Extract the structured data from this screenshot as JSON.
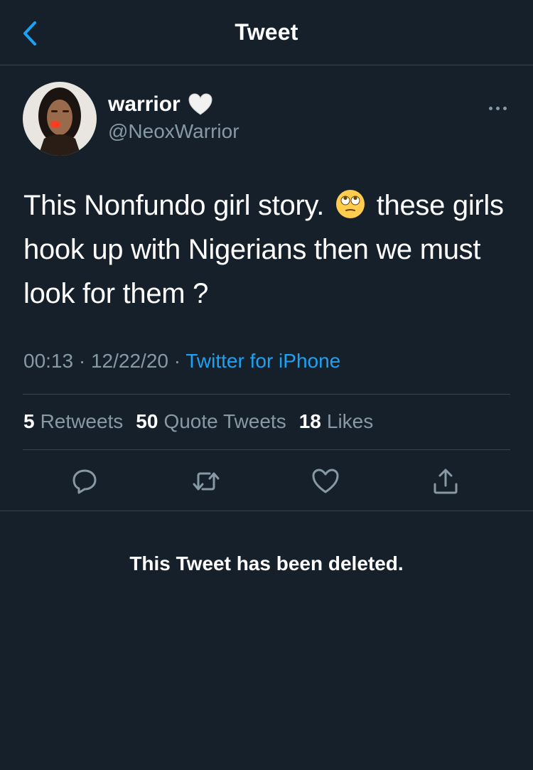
{
  "header": {
    "title": "Tweet",
    "back_icon": "chevron-left-icon"
  },
  "tweet": {
    "author": {
      "name": "warrior",
      "name_emoji": "white-heart-emoji",
      "handle": "@NeoxWarrior"
    },
    "text_part1": "This Nonfundo girl story.",
    "text_emoji": "face-with-rolling-eyes-emoji",
    "text_part2": "these girls hook up with Nigerians then we must look for them ?",
    "time": "00:13",
    "date": "12/22/20",
    "source": "Twitter for iPhone",
    "stats": {
      "retweets_count": "5",
      "retweets_label": "Retweets",
      "quotes_count": "50",
      "quotes_label": "Quote Tweets",
      "likes_count": "18",
      "likes_label": "Likes"
    },
    "actions": [
      "reply-icon",
      "retweet-icon",
      "like-icon",
      "share-icon"
    ]
  },
  "notice": {
    "deleted_text": "This Tweet has been deleted."
  },
  "colors": {
    "background": "#15202b",
    "accent": "#1da1f2",
    "muted": "#8899a6",
    "border": "#38444d"
  }
}
